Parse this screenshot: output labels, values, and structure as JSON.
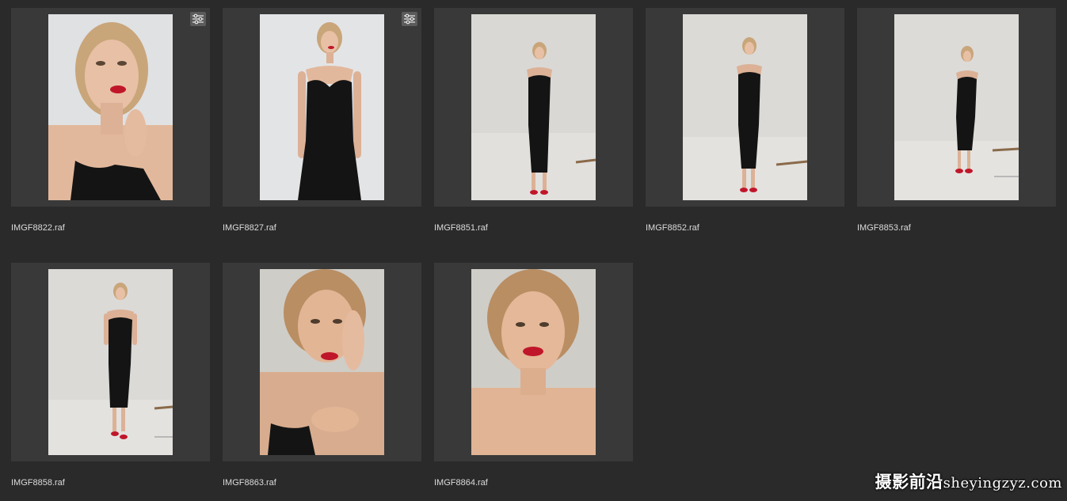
{
  "grid": {
    "items": [
      {
        "filename": "IMGF8822.raf",
        "edited": true,
        "shot": "close-portrait"
      },
      {
        "filename": "IMGF8827.raf",
        "edited": true,
        "shot": "three-quarter"
      },
      {
        "filename": "IMGF8851.raf",
        "edited": false,
        "shot": "full-body"
      },
      {
        "filename": "IMGF8852.raf",
        "edited": false,
        "shot": "full-body"
      },
      {
        "filename": "IMGF8853.raf",
        "edited": false,
        "shot": "full-body"
      },
      {
        "filename": "IMGF8858.raf",
        "edited": false,
        "shot": "full-body"
      },
      {
        "filename": "IMGF8863.raf",
        "edited": false,
        "shot": "close-portrait"
      },
      {
        "filename": "IMGF8864.raf",
        "edited": false,
        "shot": "headshot"
      }
    ]
  },
  "watermark": {
    "cjk": "摄影前沿",
    "latin": "sheyingzyz.com"
  },
  "colors": {
    "background": "#2a2a2a",
    "tile": "#393939",
    "studio_backdrop": "#d6d5d2",
    "dress": "#141414",
    "lipstick": "#c0162a",
    "skin": "#e2b89c",
    "hair": "#c9a57a"
  },
  "icons": {
    "edit_badge": "sliders-icon"
  }
}
